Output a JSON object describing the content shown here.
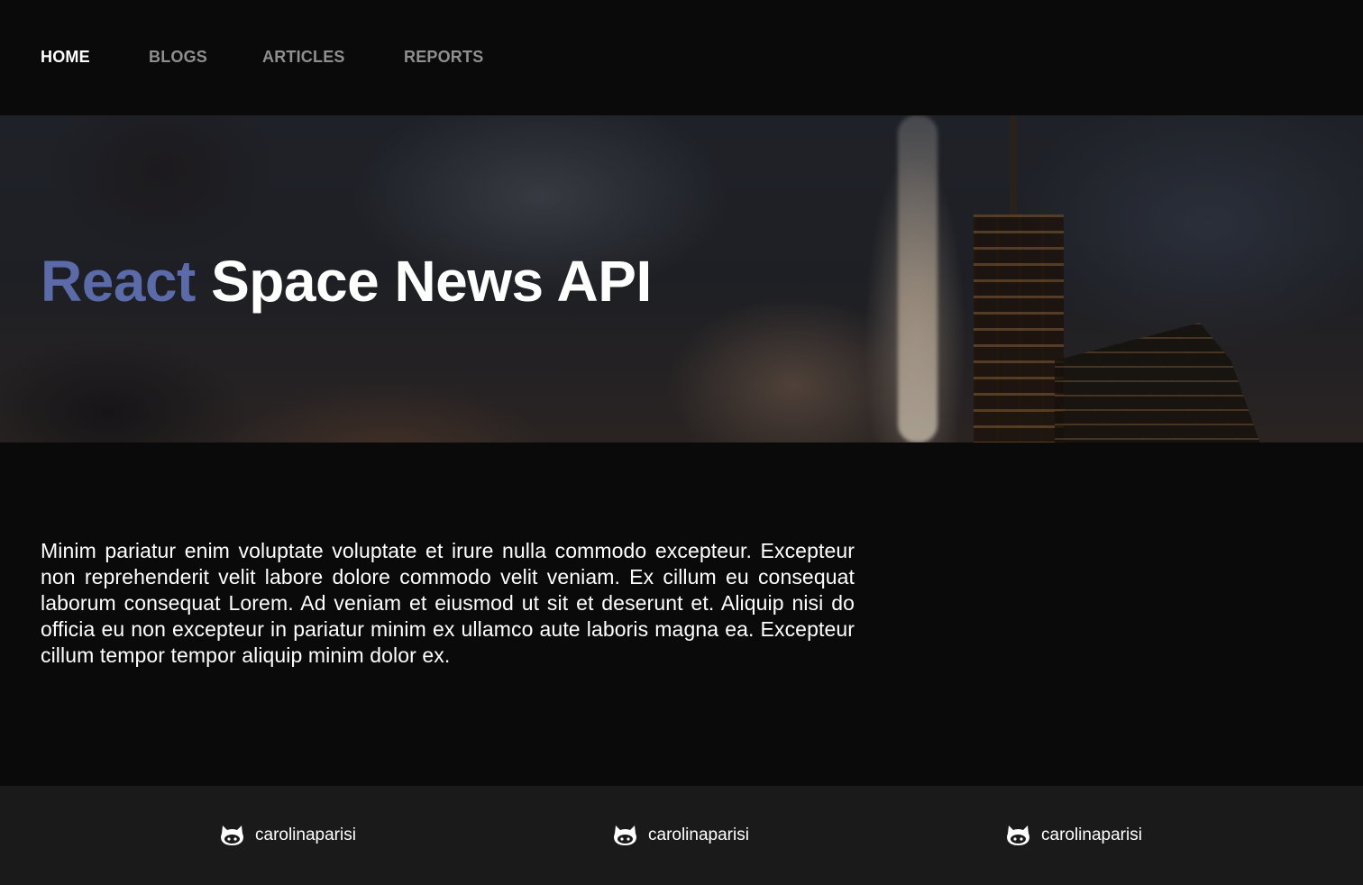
{
  "nav": {
    "items": [
      {
        "label": "HOME",
        "active": true
      },
      {
        "label": "BLOGS",
        "active": false
      },
      {
        "label": "ARTICLES",
        "active": false
      },
      {
        "label": "REPORTS",
        "active": false
      }
    ]
  },
  "hero": {
    "title_accent": "React",
    "title_rest": "Space News API",
    "accent_color": "#5b6aa8",
    "background_image": "rocket-launch-photo"
  },
  "main": {
    "paragraph": "Minim pariatur enim voluptate voluptate et irure nulla commodo excepteur. Excepteur non reprehenderit velit labore dolore commodo velit veniam. Ex cillum eu consequat laborum consequat Lorem. Ad veniam et eiusmod ut sit et deserunt et. Aliquip nisi do officia eu non excepteur in pariatur minim ex ullamco aute laboris magna ea. Excepteur cillum tempor tempor aliquip minim dolor ex."
  },
  "footer": {
    "links": [
      {
        "label": "carolinaparisi",
        "icon": "github-icon"
      },
      {
        "label": "carolinaparisi",
        "icon": "github-icon"
      },
      {
        "label": "carolinaparisi",
        "icon": "github-icon"
      }
    ]
  }
}
